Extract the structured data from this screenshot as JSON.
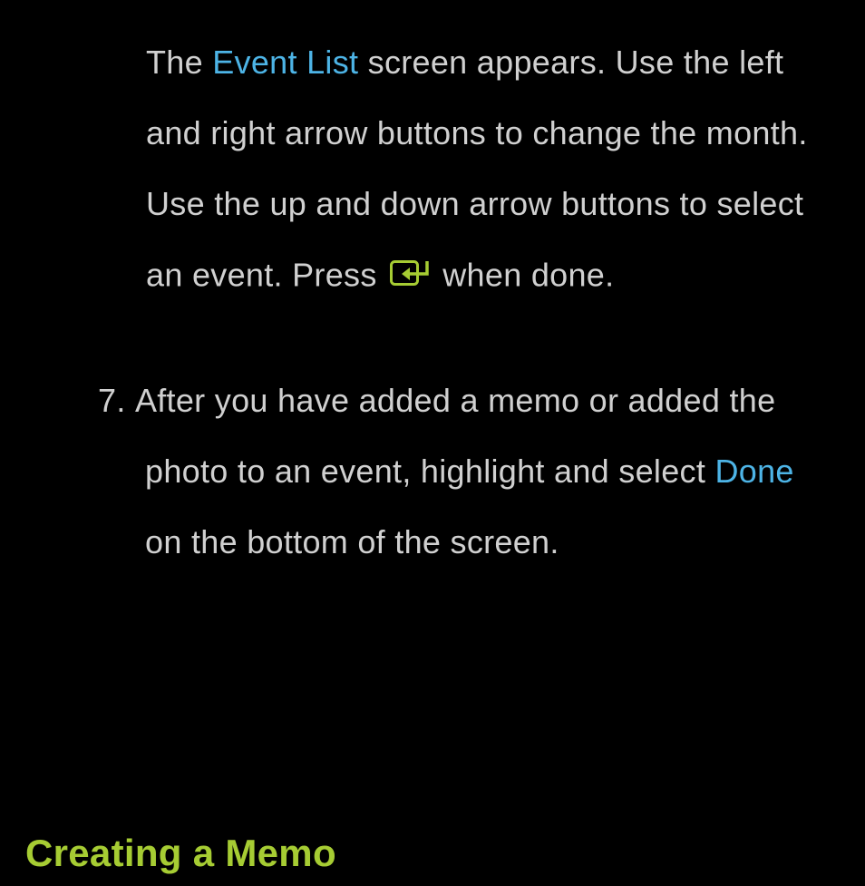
{
  "para1": {
    "text1": "The ",
    "link1": "Event List",
    "text2": " screen appears. Use the left and right arrow buttons to change the month. Use the up and down arrow buttons to select an event. Press ",
    "text3": " when done."
  },
  "step7": {
    "number": "7.",
    "text1": "After you have added a memo or added the photo to an event, highlight and select ",
    "link1": "Done",
    "text2": " on the bottom of the screen."
  },
  "heading": {
    "text": "Creating a Memo"
  },
  "icon": {
    "name": "enter-icon"
  }
}
